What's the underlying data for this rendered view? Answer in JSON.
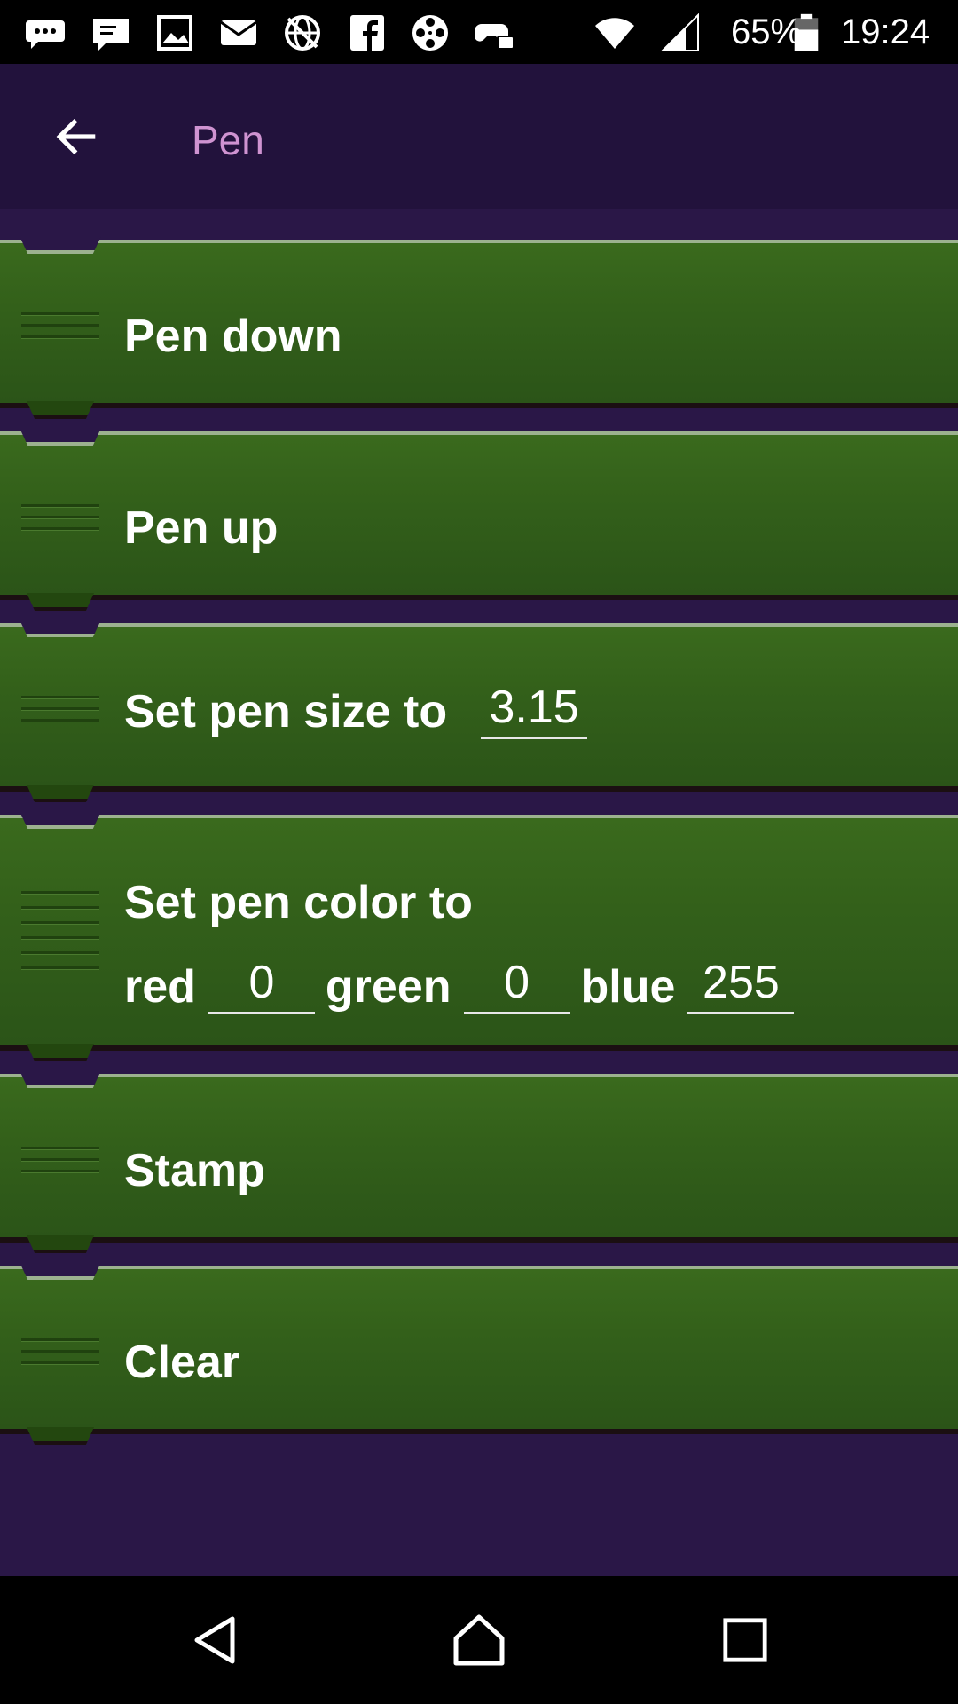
{
  "status_bar": {
    "icons": [
      "chat-bubble-icon",
      "message-icon",
      "image-icon",
      "mail-icon",
      "crossed-globe-icon",
      "facebook-icon",
      "film-reel-icon",
      "game-controller-icon",
      "wifi-icon",
      "signal-icon",
      "battery-icon"
    ],
    "battery": "65%",
    "time": "19:24"
  },
  "app_bar": {
    "title": "Pen",
    "back_icon": "arrow-left-icon"
  },
  "bricks": {
    "pen_down": {
      "label": "Pen down"
    },
    "pen_up": {
      "label": "Pen up"
    },
    "set_pen_size": {
      "label": "Set pen size to",
      "value": "3.15"
    },
    "set_pen_color": {
      "label": "Set pen color to",
      "red_label": "red",
      "red_value": "0",
      "green_label": "green",
      "green_value": "0",
      "blue_label": "blue",
      "blue_value": "255"
    },
    "stamp": {
      "label": "Stamp"
    },
    "clear": {
      "label": "Clear"
    }
  },
  "nav_bar": {
    "back": "triangle-back-icon",
    "home": "home-icon",
    "recents": "square-recents-icon"
  },
  "colors": {
    "app_bar": "#22123c",
    "content_bg": "#2a1747",
    "brick_green": "#33601a",
    "title_pink": "#cf93d1"
  }
}
